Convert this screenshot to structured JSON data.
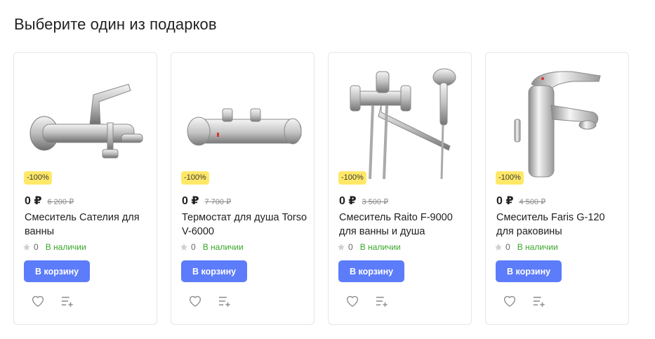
{
  "page": {
    "title": "Выберите один из подарков"
  },
  "products": [
    {
      "image": "bath-mixer-image",
      "badge": "-100%",
      "price": "0 ₽",
      "old_price": "6 200 ₽",
      "name": "Смеситель Сателия для ванны",
      "rating": "0",
      "stock": "В наличии",
      "cart_label": "В корзину"
    },
    {
      "image": "shower-thermostat-image",
      "badge": "-100%",
      "price": "0 ₽",
      "old_price": "7 700 ₽",
      "name": "Термостат для душа Torso V-6000",
      "rating": "0",
      "stock": "В наличии",
      "cart_label": "В корзину"
    },
    {
      "image": "bath-shower-mixer-image",
      "badge": "-100%",
      "price": "0 ₽",
      "old_price": "3 500 ₽",
      "name": "Смеситель Raito F-9000 для ванны и душа",
      "rating": "0",
      "stock": "В наличии",
      "cart_label": "В корзину"
    },
    {
      "image": "basin-mixer-image",
      "badge": "-100%",
      "price": "0 ₽",
      "old_price": "4 500 ₽",
      "name": "Смеситель Faris G-120 для раковины",
      "rating": "0",
      "stock": "В наличии",
      "cart_label": "В корзину"
    }
  ],
  "colors": {
    "accent": "#5c7cfa",
    "badge": "#ffe867",
    "stock": "#3aa52a"
  }
}
